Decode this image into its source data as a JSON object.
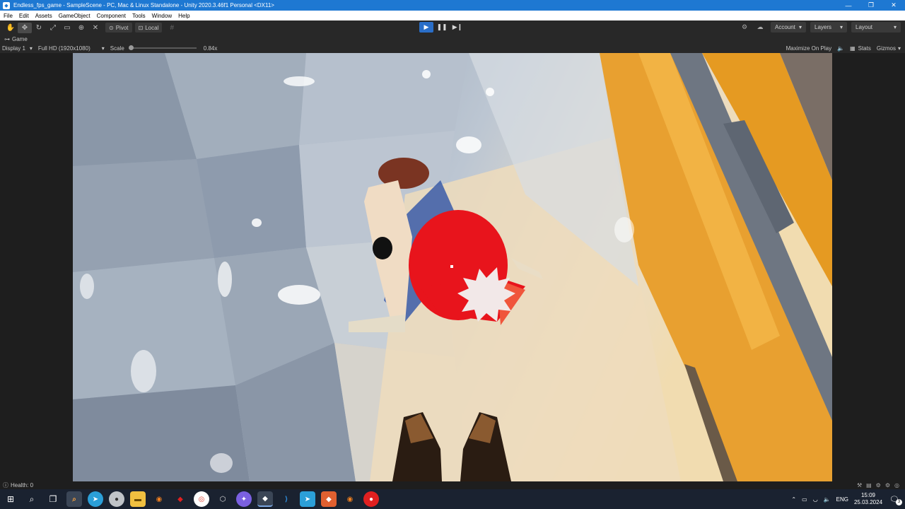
{
  "window": {
    "title": "Endless_fps_game - SampleScene - PC, Mac & Linux Standalone - Unity 2020.3.46f1 Personal <DX11>",
    "minimize": "—",
    "maximize": "❐",
    "close": "✕"
  },
  "menu": [
    "File",
    "Edit",
    "Assets",
    "GameObject",
    "Component",
    "Tools",
    "Window",
    "Help"
  ],
  "toolbar": {
    "pivot_label": "Pivot",
    "local_label": "Local",
    "account_label": "Account",
    "layers_label": "Layers",
    "layout_label": "Layout",
    "play_state": "playing"
  },
  "game_tab": {
    "tab_label": "Game",
    "display": "Display 1",
    "resolution": "Full HD (1920x1080)",
    "scale_label": "Scale",
    "scale_value": "0.84x",
    "maximize_label": "Maximize On Play",
    "stats_label": "Stats",
    "gizmos_label": "Gizmos"
  },
  "status": {
    "message": "Health: 0"
  },
  "taskbar": {
    "language": "ENG",
    "time": "15:09",
    "date": "25.03.2024",
    "notification_count": "3"
  },
  "colors": {
    "title_bar": "#1e78d2",
    "play_active": "#2a6ec8",
    "editor_bg": "#282828",
    "blood_red": "#e8141c",
    "wall_orange": "#e8a030"
  }
}
